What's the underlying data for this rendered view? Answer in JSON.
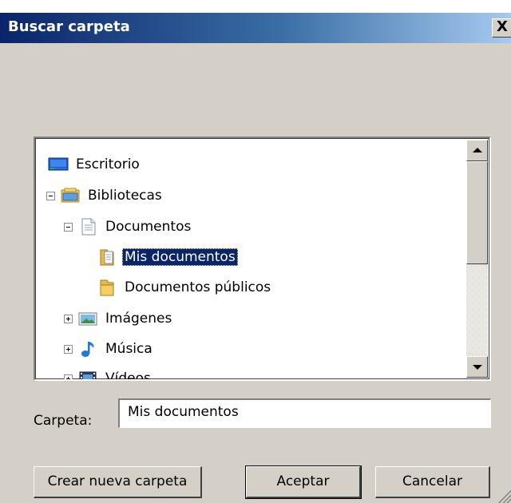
{
  "window": {
    "title": "Buscar carpeta"
  },
  "titlebar": {
    "close_glyph": "X"
  },
  "tree": {
    "items": [
      {
        "label": "Escritorio",
        "icon": "desktop-icon",
        "expander": "none"
      },
      {
        "label": "Bibliotecas",
        "icon": "libraries-icon",
        "expander": "minus"
      },
      {
        "label": "Documentos",
        "icon": "documents-icon",
        "expander": "minus"
      },
      {
        "label": "Mis documentos",
        "icon": "folder-doc-icon",
        "expander": "none",
        "selected": true
      },
      {
        "label": "Documentos públicos",
        "icon": "folder-icon",
        "expander": "none"
      },
      {
        "label": "Imágenes",
        "icon": "pictures-icon",
        "expander": "plus"
      },
      {
        "label": "Música",
        "icon": "music-icon",
        "expander": "plus"
      },
      {
        "label": "Vídeos",
        "icon": "videos-icon",
        "expander": "plus"
      }
    ]
  },
  "folder_field": {
    "label": "Carpeta:",
    "value": "Mis documentos"
  },
  "buttons": {
    "new_folder": "Crear nueva carpeta",
    "ok": "Aceptar",
    "cancel": "Cancelar"
  },
  "colors": {
    "selection": "#0a246a",
    "dialog_bg": "#d4d0c8"
  }
}
